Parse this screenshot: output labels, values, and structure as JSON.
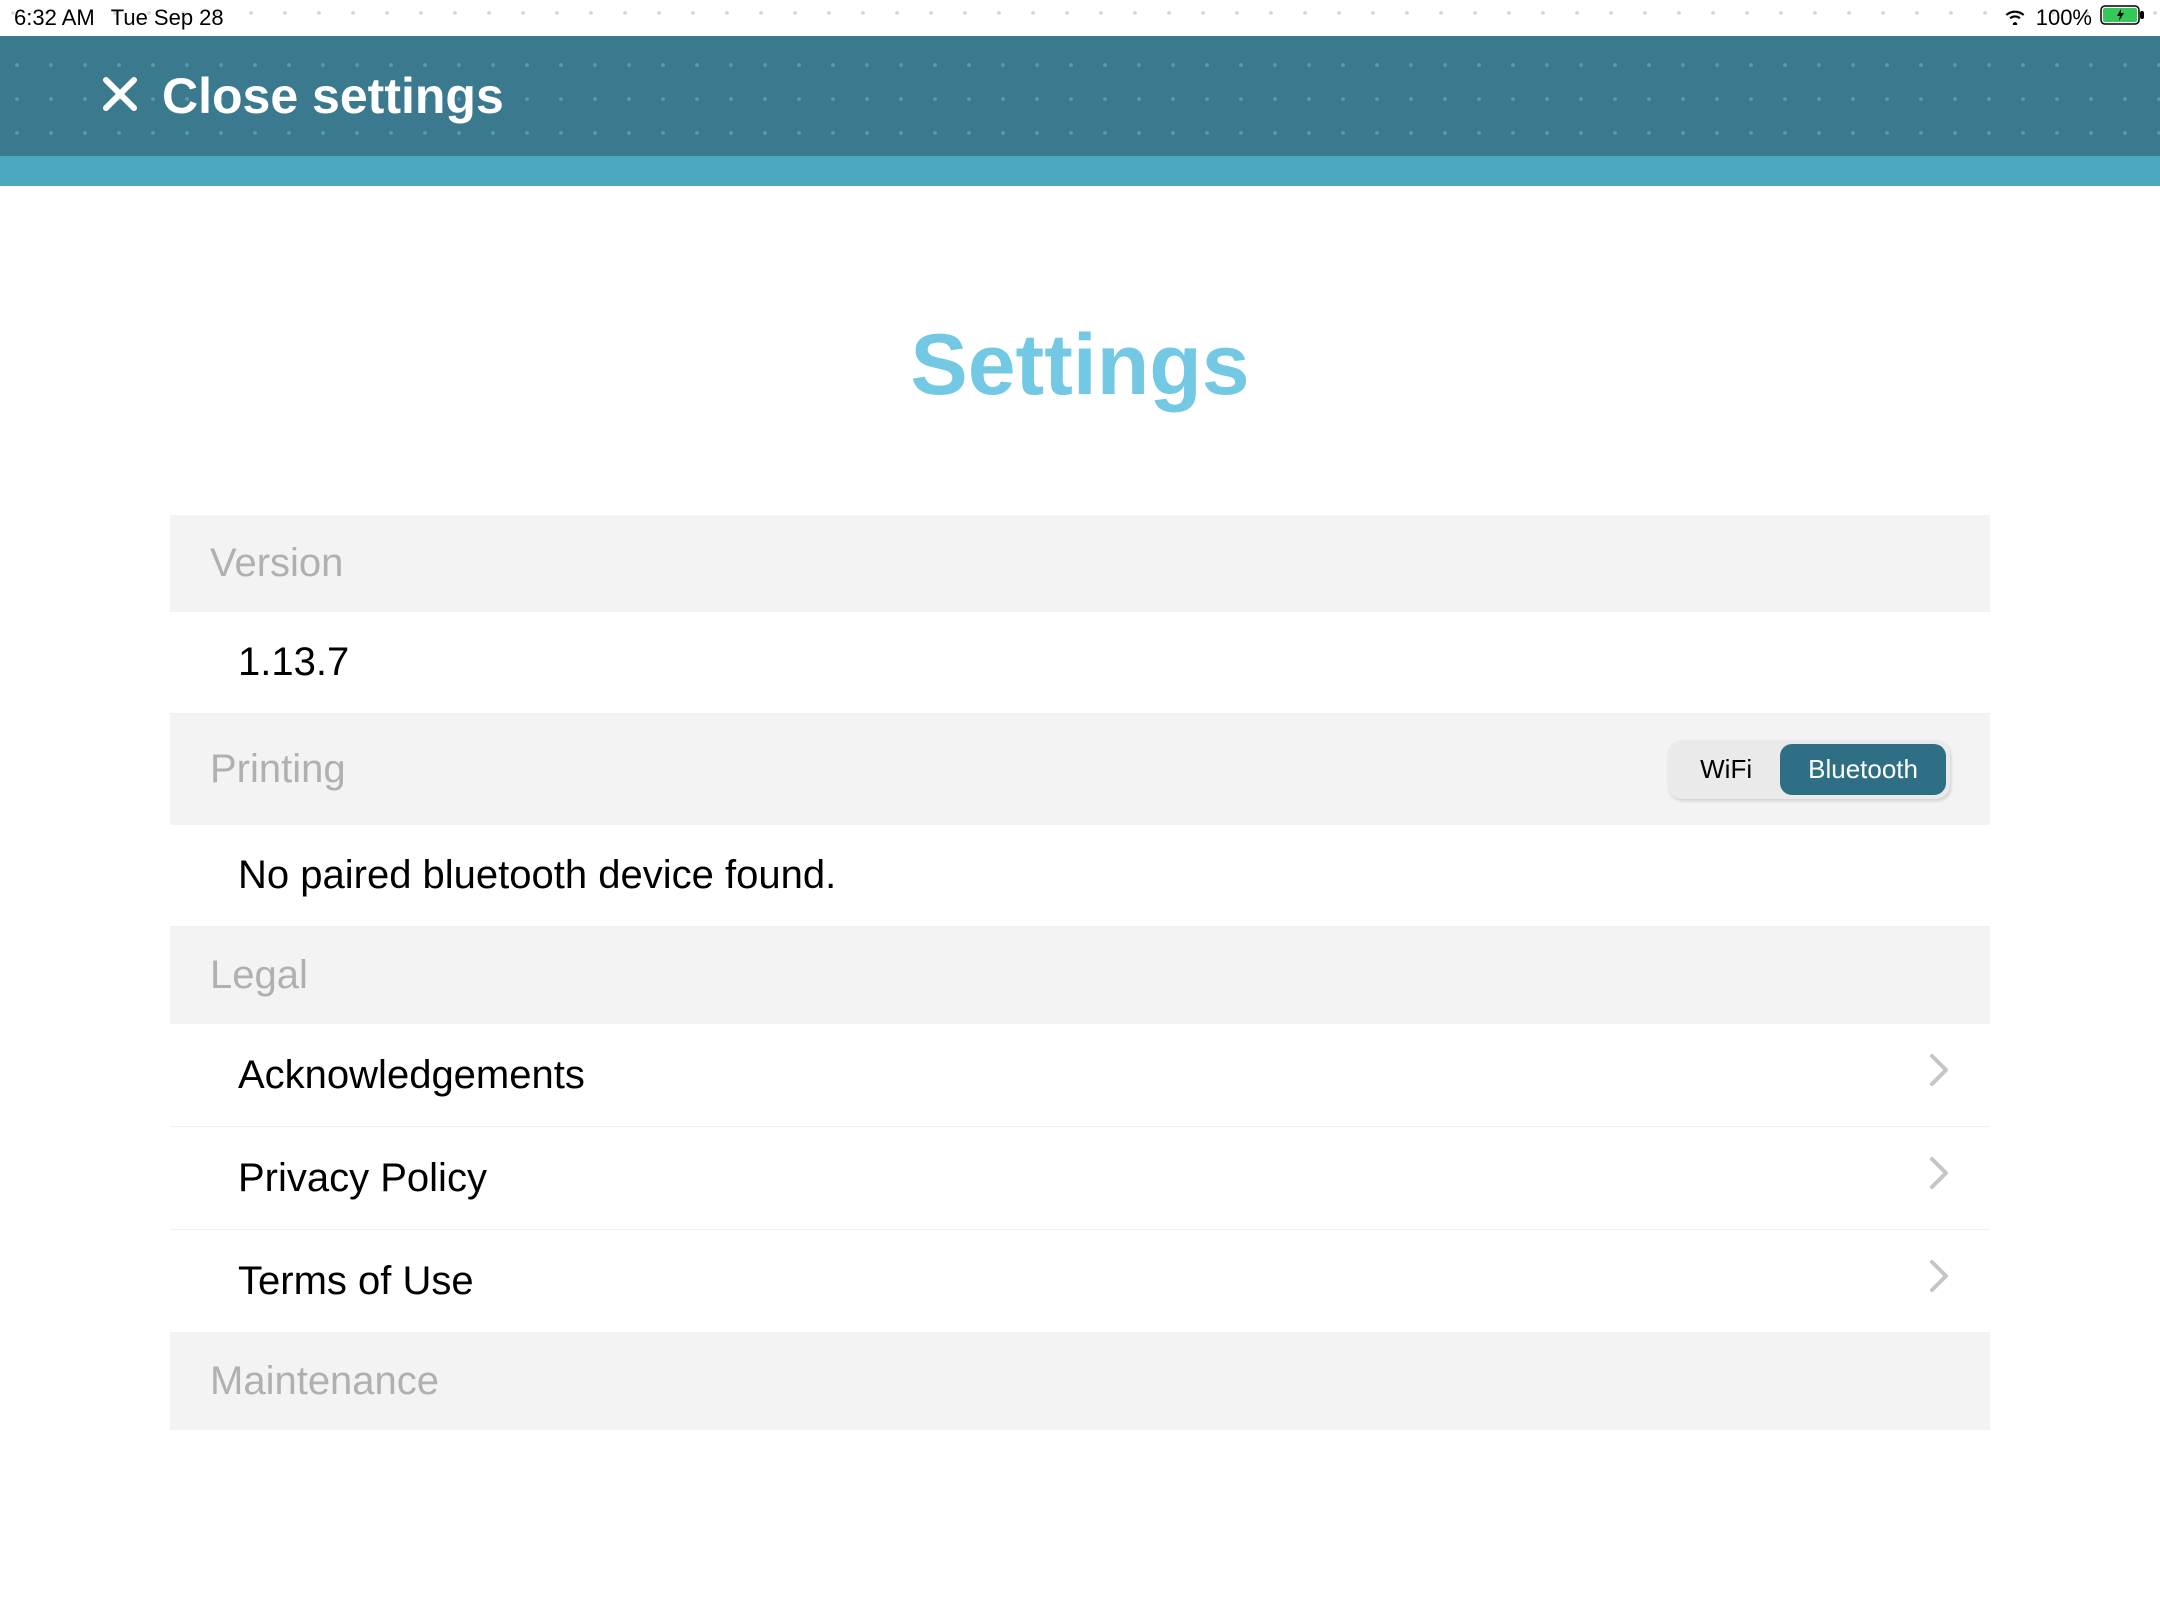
{
  "status_bar": {
    "time": "6:32 AM",
    "date": "Tue Sep 28",
    "battery_pct": "100%"
  },
  "header": {
    "close_label": "Close settings"
  },
  "page_title": "Settings",
  "sections": {
    "version": {
      "header": "Version",
      "value": "1.13.7"
    },
    "printing": {
      "header": "Printing",
      "options": {
        "wifi": "WiFi",
        "bluetooth": "Bluetooth"
      },
      "selected": "bluetooth",
      "status_text": "No paired bluetooth device found."
    },
    "legal": {
      "header": "Legal",
      "items": [
        {
          "label": "Acknowledgements"
        },
        {
          "label": "Privacy Policy"
        },
        {
          "label": "Terms of Use"
        }
      ]
    },
    "maintenance": {
      "header": "Maintenance"
    }
  }
}
